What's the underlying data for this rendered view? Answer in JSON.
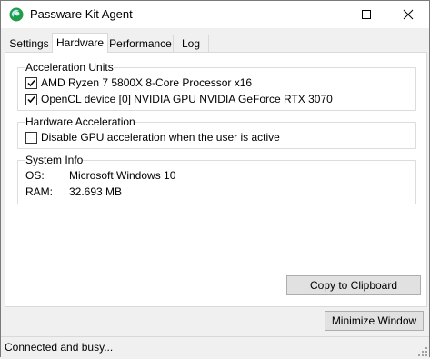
{
  "window": {
    "title": "Passware Kit Agent"
  },
  "tabs": [
    {
      "label": "Settings"
    },
    {
      "label": "Hardware"
    },
    {
      "label": "Performance"
    },
    {
      "label": "Log"
    }
  ],
  "acceleration_units": {
    "title": "Acceleration Units",
    "items": [
      {
        "label": "AMD Ryzen 7 5800X 8-Core Processor x16",
        "checked": true
      },
      {
        "label": "OpenCL device [0] NVIDIA GPU NVIDIA GeForce RTX 3070",
        "checked": true
      }
    ]
  },
  "hardware_acceleration": {
    "title": "Hardware Acceleration",
    "items": [
      {
        "label": "Disable GPU acceleration when the user is active",
        "checked": false
      }
    ]
  },
  "system_info": {
    "title": "System Info",
    "os_label": "OS:",
    "os_value": "Microsoft Windows 10",
    "ram_label": "RAM:",
    "ram_value": "32.693 MB"
  },
  "buttons": {
    "copy": "Copy to Clipboard",
    "minimize": "Minimize Window"
  },
  "status": {
    "text": "Connected and busy..."
  },
  "colors": {
    "app_icon": "#1e9e4a",
    "app_icon_highlight": "#7fd6ff"
  }
}
